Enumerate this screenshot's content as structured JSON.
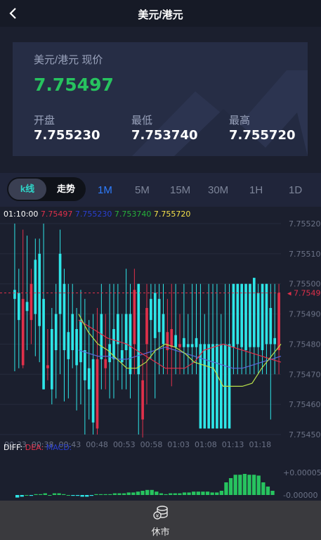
{
  "header": {
    "title": "美元/港元"
  },
  "quote": {
    "label": "美元/港元 现价",
    "price": "7.75497",
    "open_label": "开盘",
    "open": "7.755230",
    "low_label": "最低",
    "low": "7.753740",
    "high_label": "最高",
    "high": "7.755720"
  },
  "tabs": {
    "kline": "k线",
    "trend": "走势",
    "periods": [
      "1M",
      "5M",
      "15M",
      "30M",
      "1H",
      "1D"
    ],
    "active_period": "1M"
  },
  "chart_info": {
    "time": "01:10:00",
    "v1": "7.75497",
    "v2": "7.755230",
    "v3": "7.753740",
    "v4": "7.755720"
  },
  "macd": {
    "diff": "DIFF:",
    "dea": "DEA:",
    "macd": "MACD:"
  },
  "status": {
    "label": "休市"
  },
  "colors": {
    "accent": "#27c35f",
    "rise": "#2ee6e8",
    "fall": "#e0304a",
    "active_tab": "#2e7dff"
  },
  "chart_data": {
    "type": "candlestick",
    "y_ticks": [
      "7.75520",
      "7.75510",
      "7.75500",
      "7.75490",
      "7.75480",
      "7.75470",
      "7.75460",
      "7.75450"
    ],
    "y_range": [
      7.7545,
      7.7552
    ],
    "x_ticks": [
      "00:33",
      "00:38",
      "00:43",
      "00:48",
      "00:53",
      "00:58",
      "01:03",
      "01:08",
      "01:13",
      "01:18"
    ],
    "last_price_label": "7.75497",
    "macd_ticks": [
      "+0.00005",
      "-0.00000"
    ],
    "candles": [
      [
        7.75498,
        7.75495,
        7.7552,
        7.75471,
        "up"
      ],
      [
        7.75497,
        7.75488,
        7.75505,
        7.75472,
        "up"
      ],
      [
        7.75495,
        7.75473,
        7.75518,
        7.75472,
        "down"
      ],
      [
        7.75491,
        7.75494,
        7.75516,
        7.75478,
        "up"
      ],
      [
        7.755,
        7.75488,
        7.75505,
        7.7548,
        "down"
      ],
      [
        7.75508,
        7.7549,
        7.75515,
        7.75476,
        "up"
      ],
      [
        7.7551,
        7.75486,
        7.75515,
        7.75474,
        "up"
      ],
      [
        7.75495,
        7.75465,
        7.7552,
        7.75465,
        "up"
      ],
      [
        7.75473,
        7.75472,
        7.75485,
        7.75468,
        "down"
      ],
      [
        7.75485,
        7.75465,
        7.75492,
        7.7546,
        "up"
      ],
      [
        7.7549,
        7.75478,
        7.755,
        7.75462,
        "up"
      ],
      [
        7.7551,
        7.7549,
        7.75518,
        7.7547,
        "up"
      ],
      [
        7.755,
        7.75478,
        7.75505,
        7.75461,
        "up"
      ],
      [
        7.75484,
        7.75475,
        7.755,
        7.75462,
        "up"
      ],
      [
        7.7549,
        7.75478,
        7.755,
        7.75472,
        "up"
      ],
      [
        7.75485,
        7.75473,
        7.75492,
        7.75458,
        "up"
      ],
      [
        7.75488,
        7.75474,
        7.75498,
        7.7546,
        "up"
      ],
      [
        7.75478,
        7.75468,
        7.75495,
        7.7545,
        "up"
      ],
      [
        7.75472,
        7.75465,
        7.75488,
        7.75455,
        "up"
      ],
      [
        7.75475,
        7.75454,
        7.7549,
        7.7545,
        "up"
      ],
      [
        7.75475,
        7.75452,
        7.75492,
        7.7545,
        "down"
      ],
      [
        7.7549,
        7.75475,
        7.755,
        7.75465,
        "up"
      ],
      [
        7.75475,
        7.75472,
        7.7549,
        7.75465,
        "down"
      ],
      [
        7.7548,
        7.75474,
        7.755,
        7.75462,
        "up"
      ],
      [
        7.75485,
        7.75475,
        7.755,
        7.75462,
        "up"
      ],
      [
        7.7549,
        7.7548,
        7.755,
        7.75468,
        "up"
      ],
      [
        7.75478,
        7.75474,
        7.7549,
        7.75465,
        "up"
      ],
      [
        7.7549,
        7.75478,
        7.75505,
        7.75465,
        "up"
      ],
      [
        7.7549,
        7.7547,
        7.755,
        7.75462,
        "up"
      ],
      [
        7.75498,
        7.7548,
        7.75505,
        7.7547,
        "down"
      ],
      [
        7.755,
        7.7547,
        7.755,
        7.7545,
        "up"
      ],
      [
        7.75468,
        7.75455,
        7.75475,
        7.75449,
        "down"
      ],
      [
        7.75492,
        7.7548,
        7.755,
        7.7546,
        "down"
      ],
      [
        7.75495,
        7.75488,
        7.755,
        7.75475,
        "up"
      ],
      [
        7.75497,
        7.75482,
        7.755,
        7.75462,
        "up"
      ],
      [
        7.75495,
        7.75484,
        7.755,
        7.7547,
        "up"
      ],
      [
        7.7549,
        7.7548,
        7.755,
        7.7547,
        "up"
      ],
      [
        7.75484,
        7.75478,
        7.75495,
        7.7547,
        "down"
      ],
      [
        7.75485,
        7.75479,
        7.755,
        7.75466,
        "down"
      ],
      [
        7.75483,
        7.75479,
        7.755,
        7.7547,
        "up"
      ],
      [
        7.7548,
        7.75479,
        7.7549,
        7.7547,
        "down"
      ],
      [
        7.75482,
        7.75479,
        7.755,
        7.7547,
        "up"
      ],
      [
        7.7548,
        7.75479,
        7.7549,
        7.7547,
        "up"
      ],
      [
        7.7548,
        7.75479,
        7.755,
        7.7547,
        "up"
      ],
      [
        7.75482,
        7.75479,
        7.755,
        7.7547,
        "up"
      ],
      [
        7.7548,
        7.75452,
        7.755,
        7.75452,
        "up"
      ],
      [
        7.7548,
        7.75452,
        7.7549,
        7.75452,
        "up"
      ],
      [
        7.7548,
        7.75452,
        7.755,
        7.75452,
        "up"
      ],
      [
        7.7548,
        7.75452,
        7.755,
        7.75452,
        "up"
      ],
      [
        7.7548,
        7.75452,
        7.755,
        7.75452,
        "up"
      ],
      [
        7.7548,
        7.75452,
        7.7549,
        7.75452,
        "up"
      ],
      [
        7.7548,
        7.75452,
        7.755,
        7.75452,
        "up"
      ],
      [
        7.7548,
        7.75452,
        7.755,
        7.75452,
        "up"
      ],
      [
        7.755,
        7.75479,
        7.755,
        7.7547,
        "up"
      ],
      [
        7.755,
        7.7548,
        7.755,
        7.7547,
        "up"
      ],
      [
        7.755,
        7.75479,
        7.755,
        7.7547,
        "up"
      ],
      [
        7.755,
        7.75478,
        7.755,
        7.7547,
        "up"
      ],
      [
        7.755,
        7.75479,
        7.755,
        7.7547,
        "up"
      ],
      [
        7.75502,
        7.75479,
        7.75502,
        7.7547,
        "up"
      ],
      [
        7.75497,
        7.75479,
        7.755,
        7.7547,
        "up"
      ],
      [
        7.755,
        7.75478,
        7.755,
        7.7547,
        "up"
      ],
      [
        7.755,
        7.7548,
        7.755,
        7.7547,
        "up"
      ],
      [
        7.75492,
        7.7548,
        7.755,
        7.75455,
        "up"
      ],
      [
        7.7548,
        7.75482,
        7.755,
        7.7547,
        "up"
      ],
      [
        7.75497,
        7.75478,
        7.755,
        7.7547,
        "down"
      ]
    ],
    "ma1": [
      7.75488,
      7.75486,
      7.75484,
      7.75482,
      7.75481,
      7.7548,
      7.75478,
      7.75476,
      7.75474,
      7.75472,
      7.75472,
      7.75472,
      7.75474,
      7.75478,
      7.75479,
      7.7548,
      7.75479,
      7.75478,
      7.75477,
      7.75476,
      7.75475,
      7.75474
    ],
    "ma2": [
      7.75478,
      7.75477,
      7.75476,
      7.75476,
      7.75475,
      7.75475,
      7.75476,
      7.75477,
      7.75478,
      7.75479,
      7.75478,
      7.75477,
      7.75476,
      7.75475,
      7.75474,
      7.75473,
      7.75472,
      7.75472,
      7.75473,
      7.75474,
      7.75475,
      7.75476
    ],
    "ma3": [
      7.7549,
      7.75484,
      7.7548,
      7.75478,
      7.75475,
      7.75472,
      7.75472,
      7.75474,
      7.75478,
      7.7548,
      7.75479,
      7.75477,
      7.75474,
      7.75473,
      7.75472,
      7.75466,
      7.75466,
      7.75466,
      7.75467,
      7.75472,
      7.75476,
      7.7548
    ],
    "macd_bars": [
      -0.3,
      -0.2,
      0,
      -0.1,
      0.1,
      0.1,
      0.2,
      0,
      0.2,
      0.2,
      0.1,
      0,
      -0.1,
      -0.1,
      -0.2,
      -0.2,
      -0.1,
      0.1,
      0.1,
      0.1,
      0.1,
      0.2,
      0.2,
      0.2,
      0.3,
      0.3,
      0.4,
      0.5,
      0.6,
      0.6,
      0.4,
      0.2,
      0.1,
      0.2,
      0.2,
      0.2,
      0.3,
      0.3,
      0.4,
      0.4,
      0.4,
      0.4,
      0.3,
      0.3,
      0.5,
      1.5,
      2.0,
      2.4,
      2.4,
      2.5,
      2.4,
      2.4,
      2.3,
      1.5,
      1.0,
      0.5
    ]
  }
}
